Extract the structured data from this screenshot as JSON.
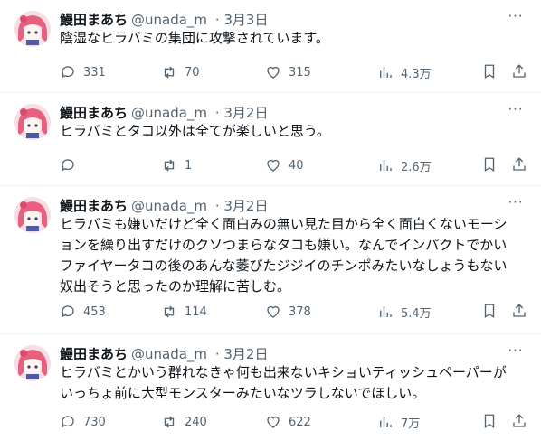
{
  "tweets": [
    {
      "name": "鰻田まあち",
      "handle": "@unada_m",
      "date": "3月3日",
      "text": "陰湿なヒラバミの集団に攻撃されています。",
      "replies": "331",
      "retweets": "70",
      "likes": "315",
      "views": "4.3万"
    },
    {
      "name": "鰻田まあち",
      "handle": "@unada_m",
      "date": "3月2日",
      "text": "ヒラバミとタコ以外は全てが楽しいと思う。",
      "replies": "",
      "retweets": "1",
      "likes": "40",
      "views": "2.6万"
    },
    {
      "name": "鰻田まあち",
      "handle": "@unada_m",
      "date": "3月2日",
      "text": "ヒラバミも嫌いだけど全く面白みの無い見た目から全く面白くないモーションを繰り出すだけのクソつまらなタコも嫌い。なんでインパクトでかいファイヤータコの後のあんな萎びたジジイのチンポみたいなしょうもない奴出そうと思ったのか理解に苦しむ。",
      "replies": "453",
      "retweets": "114",
      "likes": "378",
      "views": "5.4万"
    },
    {
      "name": "鰻田まあち",
      "handle": "@unada_m",
      "date": "3月2日",
      "text": "ヒラバミとかいう群れなきゃ何も出来ないキショいティッシュペーパーがいっちょ前に大型モンスターみたいなツラしないでほしい。",
      "replies": "730",
      "retweets": "240",
      "likes": "622",
      "views": "7万"
    }
  ],
  "icons": {
    "more": "more-horizontal-icon",
    "reply": "reply-icon",
    "retweet": "retweet-icon",
    "like": "heart-icon",
    "views": "views-chart-icon",
    "bookmark": "bookmark-icon",
    "share": "share-icon"
  },
  "colors": {
    "text": "#0f1419",
    "secondary": "#536471",
    "divider": "#eff3f4",
    "avatar_hair": "#e8607f"
  }
}
